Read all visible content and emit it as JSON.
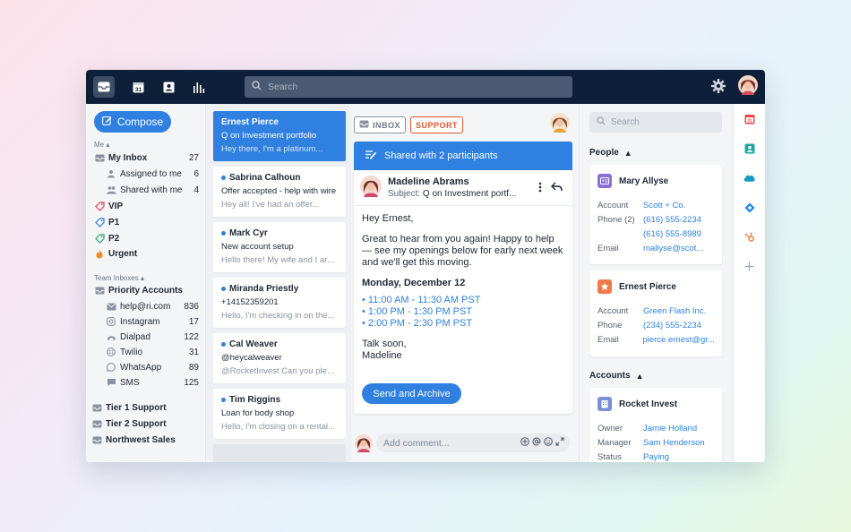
{
  "topbar": {
    "search_placeholder": "Search",
    "nav_icons": [
      "inbox-icon",
      "calendar-icon",
      "contacts-icon",
      "analytics-icon"
    ],
    "calendar_day": "31"
  },
  "sidebar": {
    "compose_label": "Compose",
    "me_section": "Me",
    "my_inbox": {
      "label": "My Inbox",
      "count": "27"
    },
    "assigned": {
      "label": "Assigned to me",
      "count": "6"
    },
    "shared": {
      "label": "Shared with me",
      "count": "4"
    },
    "tags": [
      {
        "label": "VIP",
        "color": "#e0454f"
      },
      {
        "label": "P1",
        "color": "#2f80e0"
      },
      {
        "label": "P2",
        "color": "#2aa86a"
      },
      {
        "label": "Urgent",
        "color": "#f08a2c"
      }
    ],
    "team_section": "Team Inboxes",
    "priority": {
      "label": "Priority Accounts",
      "count": ""
    },
    "channels": [
      {
        "label": "help@ri.com",
        "count": "836",
        "icon": "mail-icon"
      },
      {
        "label": "Instagram",
        "count": "17",
        "icon": "instagram-icon"
      },
      {
        "label": "Dialpad",
        "count": "122",
        "icon": "dialpad-icon"
      },
      {
        "label": "Twilio",
        "count": "31",
        "icon": "twilio-icon"
      },
      {
        "label": "WhatsApp",
        "count": "89",
        "icon": "whatsapp-icon"
      },
      {
        "label": "SMS",
        "count": "125",
        "icon": "sms-icon"
      }
    ],
    "teams": [
      "Tier 1 Support",
      "Tier 2 Support",
      "Northwest Sales"
    ]
  },
  "messages": [
    {
      "name": "Ernest Pierce",
      "subject": "Q on Investment portfolio",
      "preview": "Hey there, I'm a platinum...",
      "unread": false,
      "active": true
    },
    {
      "name": "Sabrina Calhoun",
      "subject": "Offer accepted - help with wire",
      "preview": "Hey all! I've had an offer...",
      "unread": true,
      "active": false
    },
    {
      "name": "Mark Cyr",
      "subject": "New account setup",
      "preview": "Hello there! My wife and I are...",
      "unread": true,
      "active": false
    },
    {
      "name": "Miranda Priestly",
      "subject": "+14152359201",
      "preview": "Hello, I'm checking in on the...",
      "unread": true,
      "active": false
    },
    {
      "name": "Cal Weaver",
      "subject": "@heycalweaver",
      "preview": "@RocketInvest Can you pleas...",
      "unread": true,
      "active": false
    },
    {
      "name": "Tim Riggins",
      "subject": "Loan for body shop",
      "preview": "Hello, I'm closing on a rental...",
      "unread": true,
      "active": false
    }
  ],
  "conversation": {
    "tag_inbox": "INBOX",
    "tag_support": "SUPPORT",
    "shared_banner": "Shared with 2 participants",
    "sender_name": "Madeline Abrams",
    "subject_label": "Subject:",
    "subject": "Q on Investment portf...",
    "greeting": "Hey Ernest,",
    "para1": "Great to hear from you again! Happy to help — see my openings below for early next week and we'll get this moving.",
    "date": "Monday, December 12",
    "slots": [
      "11:00 AM - 11:30 AM PST",
      "1:00 PM - 1:30 PM PST",
      "2:00 PM - 2:30 PM PST"
    ],
    "signoff": "Talk soon,",
    "signature": "Madeline",
    "send_button": "Send and Archive",
    "comment_placeholder": "Add comment..."
  },
  "right_panel": {
    "search_placeholder": "Search",
    "people_label": "People",
    "accounts_label": "Accounts",
    "people": [
      {
        "name": "Mary Allyse",
        "badge_color": "#8a6fd6",
        "fields": [
          {
            "k": "Account",
            "v": "Scott + Co."
          },
          {
            "k": "Phone (2)",
            "v": "(616) 555-2234"
          },
          {
            "k": "",
            "v": "(616) 555-8989"
          },
          {
            "k": "Email",
            "v": "mallyse@scot..."
          }
        ]
      },
      {
        "name": "Ernest Pierce",
        "badge_color": "#f07a4a",
        "fields": [
          {
            "k": "Account",
            "v": "Green Flash Inc."
          },
          {
            "k": "Phone",
            "v": "(234) 555-2234"
          },
          {
            "k": "Email",
            "v": "pierce.ernest@gr..."
          }
        ]
      }
    ],
    "account": {
      "name": "Rocket Invest",
      "badge_color": "#7b8fd8",
      "fields": [
        {
          "k": "Owner",
          "v": "Jamie Holland"
        },
        {
          "k": "Manager",
          "v": "Sam Henderson"
        },
        {
          "k": "Status",
          "v": "Paying"
        }
      ]
    }
  },
  "app_strip": {
    "apps": [
      "calendar-app-icon",
      "contacts-app-icon",
      "salesforce-icon",
      "jira-icon",
      "hubspot-icon",
      "add-app-icon"
    ],
    "calendar_day": "31"
  }
}
